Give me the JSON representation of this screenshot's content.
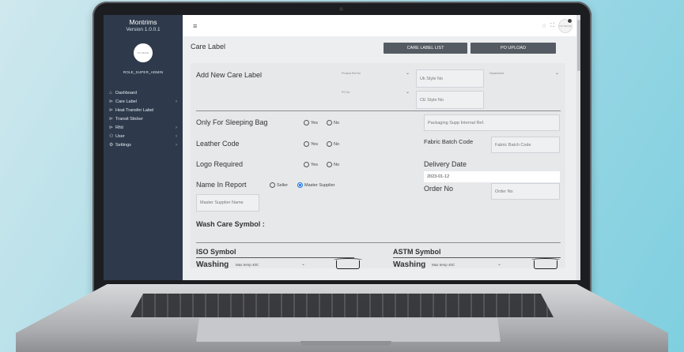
{
  "app": {
    "name": "Montrims",
    "version": "Version 1.0.0.1"
  },
  "user": {
    "role": "ROLE_SUPER_ADMIN",
    "avatar_text": "NO IMAGE"
  },
  "sidebar": {
    "items": [
      {
        "label": "Dashboard",
        "icon": "home-icon",
        "has_submenu": false
      },
      {
        "label": "Care Label",
        "icon": "tag-icon",
        "has_submenu": true
      },
      {
        "label": "Heat Transfer Label",
        "icon": "tag-icon",
        "has_submenu": false
      },
      {
        "label": "Transit Sticker",
        "icon": "tag-icon",
        "has_submenu": false
      },
      {
        "label": "Rfid",
        "icon": "tag-icon",
        "has_submenu": true
      },
      {
        "label": "User",
        "icon": "users-icon",
        "has_submenu": true
      },
      {
        "label": "Settings",
        "icon": "gear-icon",
        "has_submenu": true
      }
    ]
  },
  "page": {
    "title": "Care Label",
    "care_label_list_button": "CARE LABEL LIST",
    "po_upload_button": "PO UPLOAD"
  },
  "form": {
    "heading": "Add New Care Label",
    "product_ref_placeholder": "Product Ref No",
    "po_no_placeholder": "PO No",
    "uk_style_placeholder": "Uk Style No",
    "ce_style_placeholder": "CE Style No",
    "department_placeholder": "Department",
    "sleeping_bag_label": "Only For Sleeping Bag",
    "leather_code_label": "Leather Code",
    "logo_required_label": "Logo Required",
    "yes_label": "Yes",
    "no_label": "No",
    "packaging_ref_placeholder": "Packaging Supp Internal Ref.",
    "fabric_batch_label": "Fabric Batch Code",
    "fabric_batch_placeholder": "Fabric Batch Code",
    "delivery_date_label": "Delivery Date",
    "delivery_date_value": "2023-01-12",
    "order_no_label": "Order No",
    "order_no_placeholder": "Order No",
    "name_in_report_label": "Name In Report",
    "seller_option": "Seller",
    "master_supplier_option": "Master Supplier",
    "name_in_report_selected": "Master Supplier",
    "master_supplier_placeholder": "Master Supplier Name",
    "wash_care_heading": "Wash Care Symbol :",
    "iso_heading": "ISO Symbol",
    "astm_heading": "ASTM Symbol",
    "washing_label": "Washing",
    "iso_washing_value": "Max temp 40C",
    "astm_washing_value": "Max temp 40C"
  }
}
